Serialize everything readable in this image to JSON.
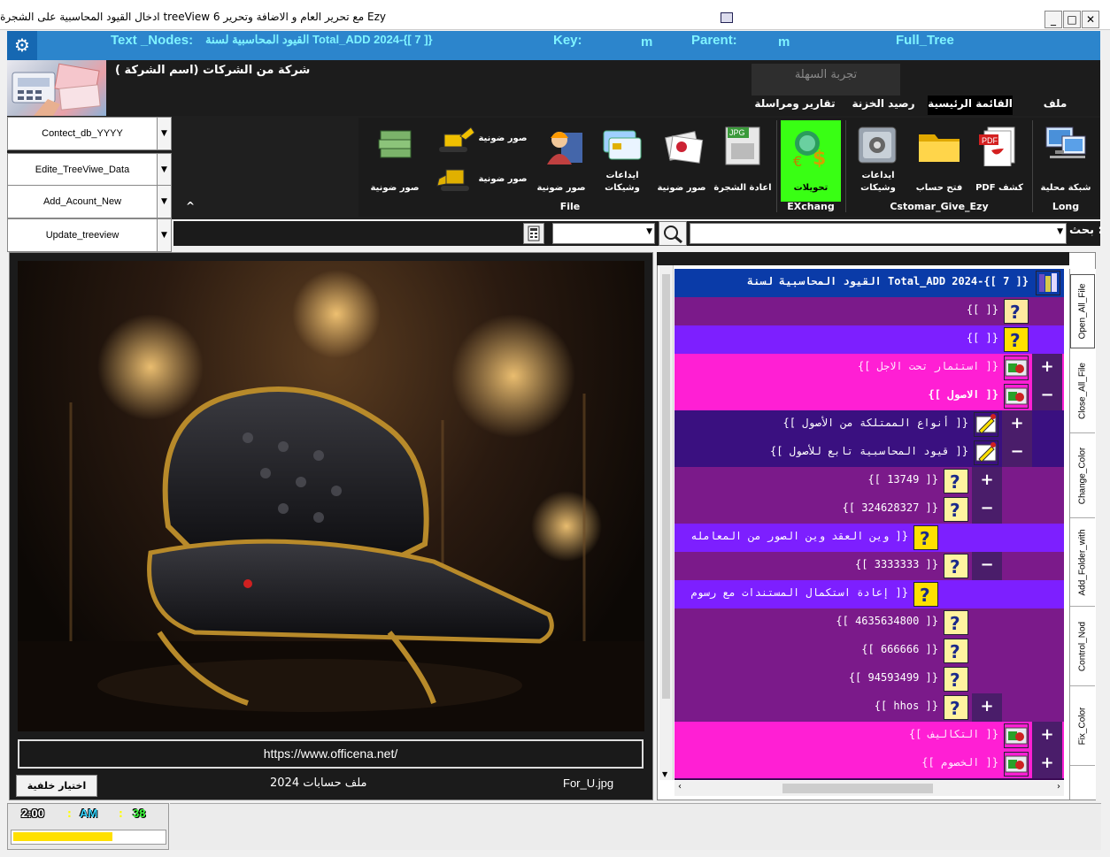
{
  "window": {
    "title": "Ezy مع تحرير العام و الاضافة وتحرير treeView 6 ادخال القيود المحاسبية على الشجرة",
    "min_glyph": "_",
    "max_glyph": "□",
    "close_glyph": "✕"
  },
  "header": {
    "text_nodes_label": "Text _Nodes:",
    "text_nodes_value": "{[ 7 ]}-Total_ADD 2024 القيود المحاسبية لسنة",
    "key_label": "Key:",
    "key_value": "m",
    "parent_label": "Parent:",
    "parent_value": "m",
    "full_tree": "Full_Tree"
  },
  "company": "شركة من الشركات (اسم الشركة )",
  "trial_label": "تجربة السهلة",
  "tabs": [
    {
      "label": "ملف"
    },
    {
      "label": "القائمة الرئيسية"
    },
    {
      "label": "رصيد الخزنة"
    },
    {
      "label": "تقارير ومراسلة"
    }
  ],
  "ribbon": {
    "buttons": [
      {
        "label": "شبكة محلية"
      },
      {
        "label": "كشف PDF"
      },
      {
        "label": "فتح حساب"
      },
      {
        "label": "ايداعات\nوشيكات"
      },
      {
        "label": "تحويلات"
      },
      {
        "label": "اعادة الشجرة"
      },
      {
        "label": "صور ضونية"
      },
      {
        "label": "ايداعات\nوشيكات"
      },
      {
        "label": "صور ضونية"
      },
      {
        "label": "صور ضونية"
      },
      {
        "label": "صور ضونية"
      },
      {
        "label": "صور ضونية"
      }
    ],
    "groups": [
      {
        "label": "Long"
      },
      {
        "label": "Cstomar_Give_Ezy"
      },
      {
        "label": "EXchang"
      },
      {
        "label": "File"
      }
    ],
    "collapse_glyph": "^"
  },
  "left_buttons": [
    {
      "label": "Contect_db_YYYY"
    },
    {
      "label": "Edite_TreeViwe_Data"
    },
    {
      "label": "Add_Acount_New"
    },
    {
      "label": "Update_treeview"
    }
  ],
  "search": {
    "label": ": بحث"
  },
  "image_panel": {
    "url": "https://www.officena.net/",
    "bg_button": "اختيار خلفية",
    "year_label": "ملف حسابات 2024",
    "file_name": "For_U.jpg"
  },
  "tree": {
    "rows": [
      {
        "text": "{[ 7 ]}-Total_ADD 2024 القيود المحاسبية لسنة",
        "bg": "#0a3ba8",
        "color": "#ffffff",
        "bold": true,
        "icon": "book-icon",
        "icon_color": "#e0d8ff",
        "text_right": 40,
        "icon_right": 0
      },
      {
        "text": "{[ ]}",
        "bg": "#7b1a8a",
        "color": "#ffffff",
        "icon": "question-icon",
        "icon_color": "#ffe9a0",
        "text_right": 74,
        "icon_right": 36
      },
      {
        "text": "{[ ]}",
        "bg": "#7d1fff",
        "color": "#ffffff",
        "icon": "question-icon",
        "icon_color": "#ffe000",
        "text_right": 74,
        "icon_right": 36
      },
      {
        "text": "{[ استثمار تحت الاجل ]}",
        "bg": "#ff1fd4",
        "color": "#ffe9ff",
        "icon": "folder-icon",
        "icon_color": "#cc2222",
        "pm": "+",
        "text_right": 74,
        "icon_right": 36
      },
      {
        "text": "{[ الاصول ]}",
        "bg": "#ff1fd4",
        "color": "#ffffff",
        "bold": true,
        "icon": "folder-icon",
        "icon_color": "#cc2222",
        "pm": "−",
        "text_right": 74,
        "icon_right": 36
      },
      {
        "text": "{[ أنواع الممتلكة من الأصول ]}",
        "bg": "#3a1080",
        "color": "#ffffff",
        "icon": "pencil-icon",
        "icon_color": "#ffe000",
        "pm": "+",
        "text_right": 108,
        "icon_right": 70
      },
      {
        "text": "{[ قيود المحاسبية تابع للأصول ]}",
        "bg": "#3a1080",
        "color": "#ffffff",
        "icon": "pencil-icon",
        "icon_color": "#ffe000",
        "pm": "−",
        "text_right": 108,
        "icon_right": 70
      },
      {
        "text": "{[ 13749 ]}",
        "bg": "#7b1a8a",
        "color": "#ffffff",
        "icon": "question-icon",
        "icon_color": "#fff3a0",
        "pm": "+",
        "text_right": 142,
        "icon_right": 104
      },
      {
        "text": "{[ 324628327 ]}",
        "bg": "#7b1a8a",
        "color": "#ffffff",
        "icon": "question-icon",
        "icon_color": "#fff3a0",
        "pm": "−",
        "text_right": 142,
        "icon_right": 104
      },
      {
        "text": "{[ وين العقد وين الصور من المعامله",
        "bg": "#7d1fff",
        "color": "#ffffff",
        "icon": "question-icon",
        "icon_color": "#ffe000",
        "text_right": 176,
        "icon_right": 138
      },
      {
        "text": "{[ 3333333 ]}",
        "bg": "#7b1a8a",
        "color": "#ffffff",
        "icon": "question-icon",
        "icon_color": "#fff3a0",
        "pm": "−",
        "text_right": 142,
        "icon_right": 104
      },
      {
        "text": "{[ إعادة استكمال المستندات مع رسوم",
        "bg": "#7d1fff",
        "color": "#ffffff",
        "icon": "question-icon",
        "icon_color": "#ffe000",
        "text_right": 176,
        "icon_right": 138
      },
      {
        "text": "{[ 4635634800 ]}",
        "bg": "#7b1a8a",
        "color": "#ffffff",
        "icon": "question-icon",
        "icon_color": "#fff3a0",
        "text_right": 142,
        "icon_right": 104
      },
      {
        "text": "{[ 666666 ]}",
        "bg": "#7b1a8a",
        "color": "#ffffff",
        "icon": "question-icon",
        "icon_color": "#fff3a0",
        "text_right": 142,
        "icon_right": 104
      },
      {
        "text": "{[ 94593499 ]}",
        "bg": "#7b1a8a",
        "color": "#ffffff",
        "icon": "question-icon",
        "icon_color": "#fff3a0",
        "text_right": 142,
        "icon_right": 104
      },
      {
        "text": "{[ hhos ]}",
        "bg": "#7b1a8a",
        "color": "#ffffff",
        "icon": "question-icon",
        "icon_color": "#fff3a0",
        "pm": "+",
        "text_right": 142,
        "icon_right": 104
      },
      {
        "text": "{[ التكاليف ]}",
        "bg": "#ff1fd4",
        "color": "#ffe9ff",
        "icon": "folder-icon",
        "icon_color": "#cc2222",
        "pm": "+",
        "text_right": 74,
        "icon_right": 36
      },
      {
        "text": "{[ الخصوم ]}",
        "bg": "#ff1fd4",
        "color": "#ffe9ff",
        "icon": "folder-icon",
        "icon_color": "#cc2222",
        "pm": "+",
        "text_right": 74,
        "icon_right": 36
      }
    ]
  },
  "sidebar_tabs": [
    {
      "label": "Open_All_File"
    },
    {
      "label": "Close_All_File"
    },
    {
      "label": "Change_Color"
    },
    {
      "label": "Add_Folder_with"
    },
    {
      "label": "Control_Nod"
    },
    {
      "label": "Fix_Color"
    }
  ],
  "status": {
    "time": "2:00",
    "ampm": "AM",
    "seconds": "38",
    "colon": ":",
    "progress_fraction": 0.66
  },
  "colors": {
    "header_blue": "#2c85cc",
    "header_text": "#7ff3ff",
    "exchange_green": "#39ff14"
  }
}
